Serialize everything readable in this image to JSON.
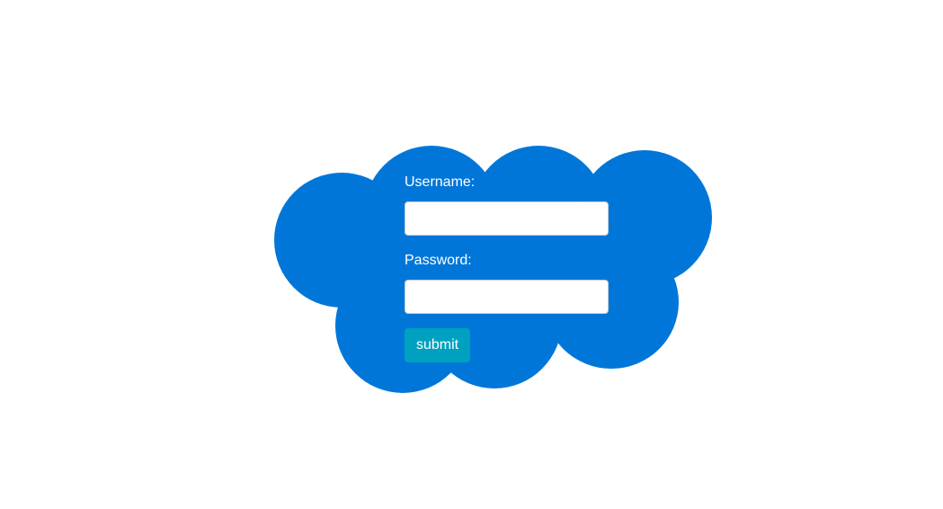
{
  "colors": {
    "cloud": "#0077d8",
    "button": "#00a1c0",
    "label_text": "#ffffff",
    "background": "#ffffff"
  },
  "form": {
    "username_label": "Username:",
    "username_value": "",
    "password_label": "Password:",
    "password_value": "",
    "submit_label": "submit"
  }
}
